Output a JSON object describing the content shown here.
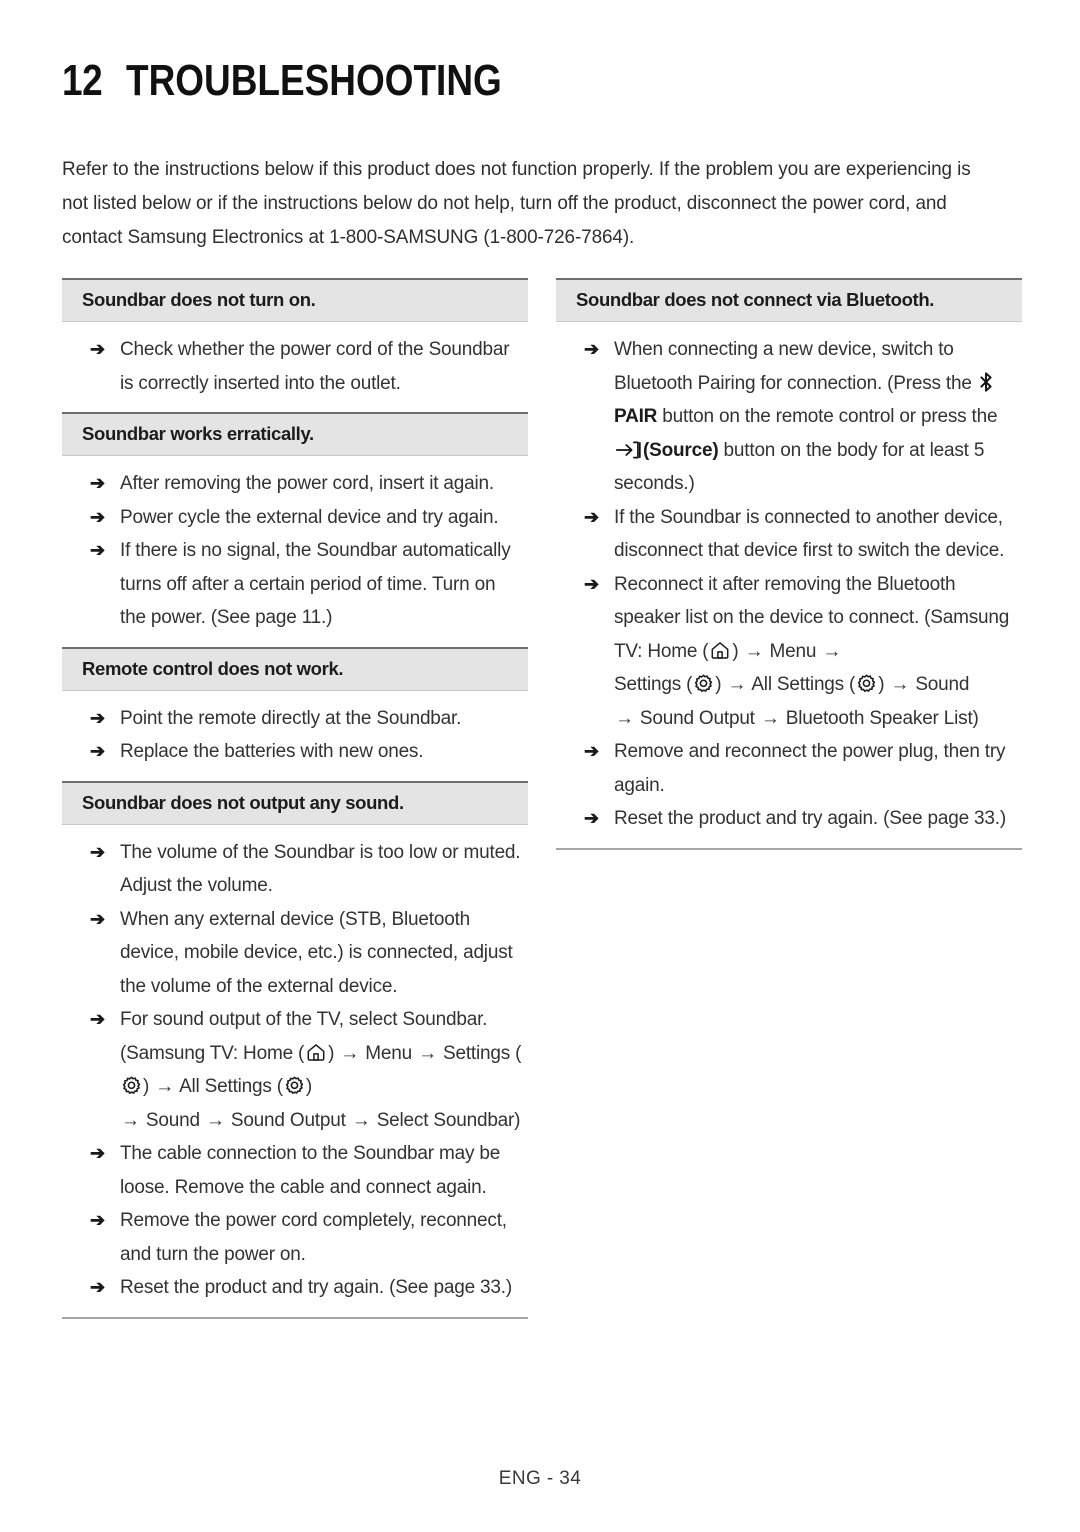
{
  "page": {
    "chapter_number": "12",
    "chapter_title": "TROUBLESHOOTING",
    "footer": "ENG - 34",
    "intro": "Refer to the instructions below if this product does not function properly. If the problem you are experiencing is not listed below or if the instructions below do not help, turn off the product, disconnect the power cord, and contact Samsung Electronics at 1-800-SAMSUNG (1-800-726-7864).",
    "bullet_glyph": "➔",
    "inline_arrow": "→",
    "colors": {
      "header_band": "#e4e4e4",
      "header_rule": "#6f6f6f",
      "closing_rule": "#a6a6a6",
      "text": "#333333"
    }
  },
  "left_column": {
    "sections": [
      {
        "header": "Soundbar does not turn on.",
        "bullets": [
          "Check whether the power cord of the Soundbar is correctly inserted into the outlet."
        ]
      },
      {
        "header": "Soundbar works erratically.",
        "bullets": [
          "After removing the power cord, insert it again.",
          "Power cycle the external device and try again.",
          "If there is no signal, the Soundbar automatically turns off after a certain period of time. Turn on the power. (See page 11.)"
        ]
      },
      {
        "header": "Remote control does not work.",
        "bullets": [
          "Point the remote directly at the Soundbar.",
          "Replace the batteries with new ones."
        ]
      },
      {
        "header": "Soundbar does not output any sound.",
        "bullets": [
          "The volume of the Soundbar is too low or muted. Adjust the volume.",
          "When any external device (STB, Bluetooth device, mobile device, etc.) is connected, adjust the volume of the external device.",
          "TV_PATH_BULLET",
          "The cable connection to the Soundbar may be loose. Remove the cable and connect again.",
          "Remove the power cord completely, reconnect, and turn the power on.",
          "Reset the product and try again. (See page 33.)"
        ]
      }
    ],
    "tv_path_bullet": {
      "part1": "For sound output of the TV, select Soundbar. (Samsung TV: Home (",
      "part2": ") ",
      "label_menu": "Menu ",
      "label_settings": "Settings (",
      "part3": ") ",
      "label_all_settings": "All Settings (",
      "part4": ") ",
      "label_sound": "Sound ",
      "label_sound_output": "Sound Output ",
      "label_select_soundbar": "Select Soundbar)"
    }
  },
  "right_column": {
    "sections": [
      {
        "header": "Soundbar does not connect via Bluetooth.",
        "bullets": [
          "PAIR_BULLET",
          "If the Soundbar is connected to another device, disconnect that device first to switch the device.",
          "RECONNECT_BULLET",
          "Remove and reconnect the power plug, then try again.",
          "Reset the product and try again. (See page 33.)"
        ]
      }
    ],
    "pair_bullet": {
      "part1": "When connecting a new device, switch to Bluetooth Pairing for connection. (Press the ",
      "pair_label": "PAIR",
      "part2": " button on the remote control or press the ",
      "source_label": "(Source)",
      "part3": " button on the body for at least 5 seconds.)"
    },
    "reconnect_bullet": {
      "part1": "Reconnect it after removing the Bluetooth speaker list on the device to connect. (Samsung TV: Home (",
      "part2": ") ",
      "label_menu": "Menu ",
      "label_settings": "Settings (",
      "part3": ") ",
      "label_all_settings": "All Settings (",
      "part4": ") ",
      "label_sound": "Sound ",
      "label_sound_output": "Sound Output ",
      "label_bt_speaker_list": "Bluetooth Speaker List)"
    }
  },
  "icons": {
    "home": "home-icon",
    "settings": "gear-icon",
    "bluetooth": "bluetooth-icon",
    "source": "source-input-icon"
  }
}
